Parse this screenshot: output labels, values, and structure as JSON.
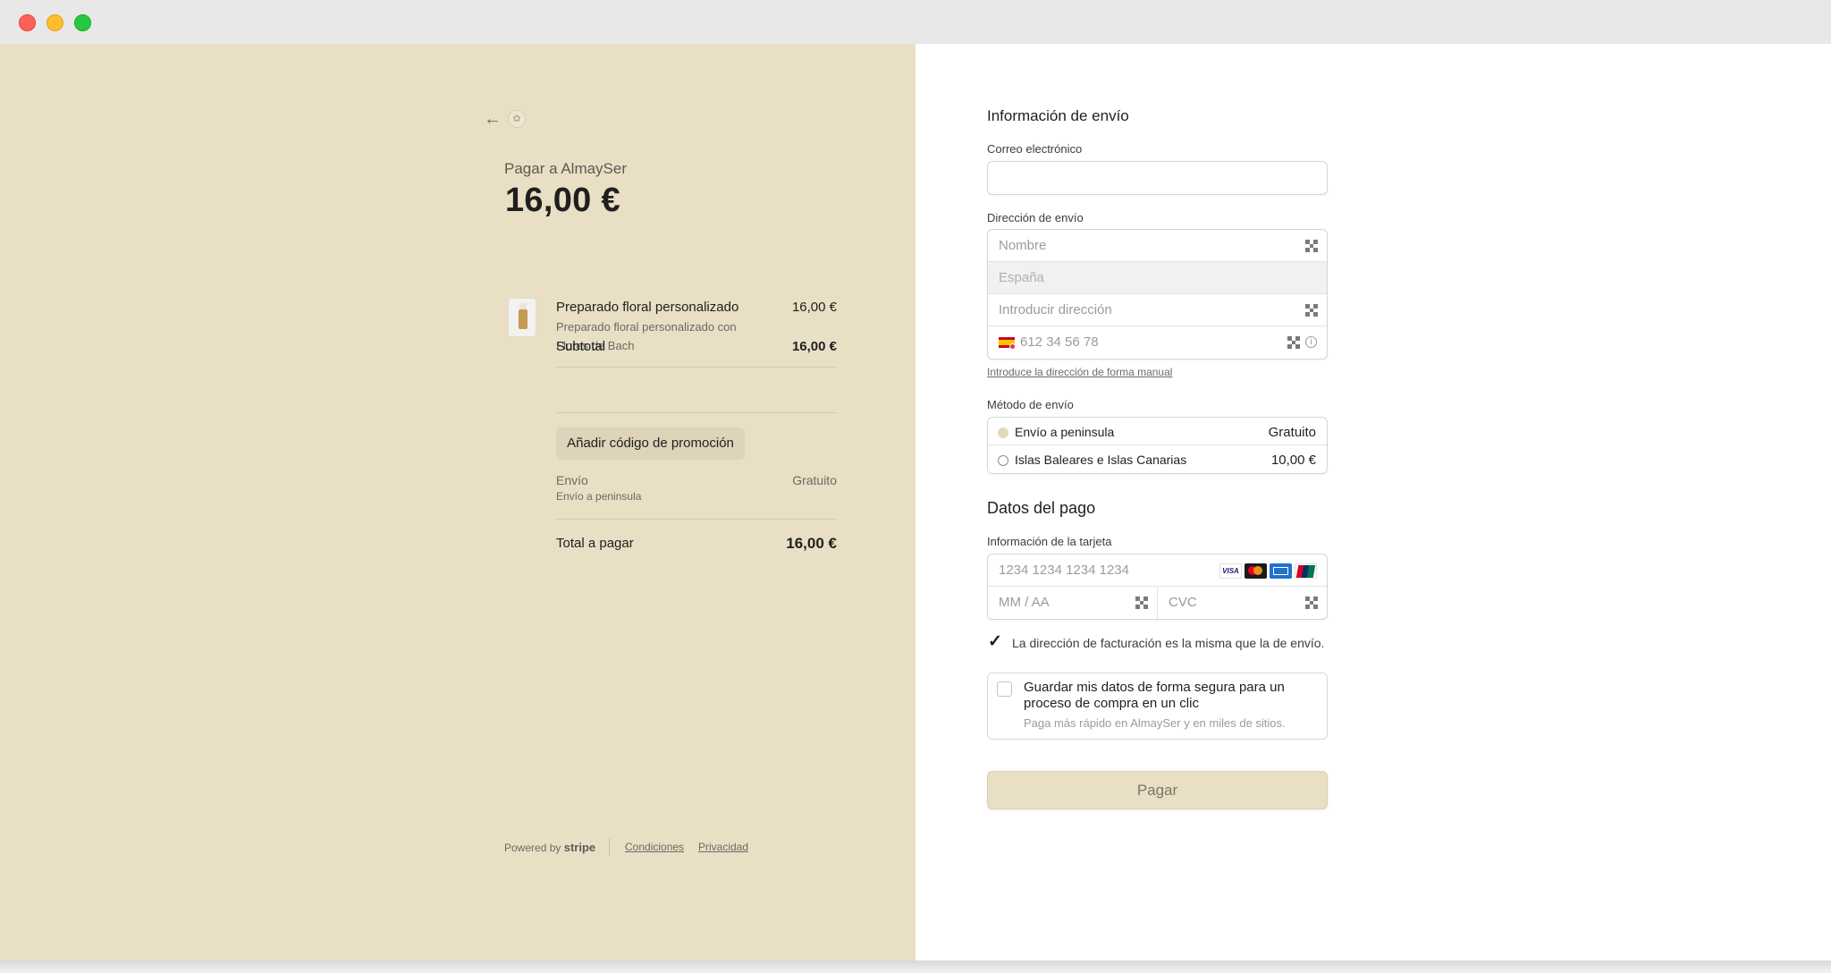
{
  "summary": {
    "back_icon": "arrow-left-icon",
    "pay_to": "Pagar a AlmaySer",
    "amount": "16,00 €",
    "product": {
      "name": "Preparado floral personalizado",
      "description": "Preparado floral personalizado con Flores de Bach",
      "price": "16,00 €"
    },
    "subtotal_label": "Subtotal",
    "subtotal_value": "16,00 €",
    "promo_button": "Añadir código de promoción",
    "shipping_label": "Envío",
    "shipping_method": "Envío a peninsula",
    "shipping_value": "Gratuito",
    "total_label": "Total a pagar",
    "total_value": "16,00 €",
    "footer": {
      "powered_by": "Powered by",
      "brand": "stripe",
      "terms": "Condiciones",
      "privacy": "Privacidad"
    },
    "background_color": "#e8dfc5"
  },
  "form": {
    "shipping_title": "Información de envío",
    "email_label": "Correo electrónico",
    "email_value": "",
    "address_label": "Dirección de envío",
    "name_placeholder": "Nombre",
    "country_placeholder": "España",
    "address_placeholder": "Introducir dirección",
    "phone_placeholder": "612 34 56 78",
    "manual_link": "Introduce la dirección de forma manual",
    "method_label": "Método de envío",
    "methods": [
      {
        "label": "Envío a peninsula",
        "price": "Gratuito",
        "selected": true
      },
      {
        "label": "Islas Baleares e Islas Canarias",
        "price": "10,00 €",
        "selected": false
      }
    ],
    "payment_title": "Datos del pago",
    "card_label": "Información de la tarjeta",
    "card_number_placeholder": "1234 1234 1234 1234",
    "card_brands": [
      "VISA",
      "mastercard",
      "amex",
      "unionpay"
    ],
    "expiry_placeholder": "MM / AA",
    "cvc_placeholder": "CVC",
    "billing_same_label": "La dirección de facturación es la misma que la de envío.",
    "billing_same_checked": true,
    "save_title": "Guardar mis datos de forma segura para un proceso de compra en un clic",
    "save_subtitle": "Paga más rápido en AlmaySer y en miles de sitios.",
    "save_checked": false,
    "pay_button": "Pagar",
    "accent_color": "#e8dfc5"
  }
}
